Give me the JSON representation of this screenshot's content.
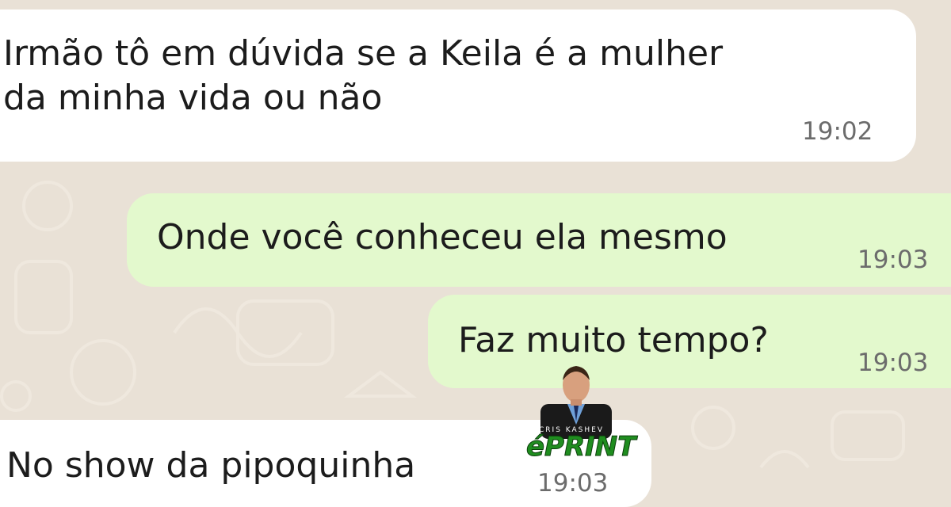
{
  "messages": [
    {
      "direction": "incoming",
      "text": "Irmão tô em dúvida se a Keila é a mulher\nda minha vida ou não",
      "time": "19:02"
    },
    {
      "direction": "outgoing",
      "text": "Onde você conheceu ela mesmo",
      "time": "19:03"
    },
    {
      "direction": "outgoing",
      "text": "Faz muito tempo?",
      "time": "19:03"
    },
    {
      "direction": "incoming",
      "text": "No show da pipoquinha",
      "time": "19:03"
    }
  ],
  "watermark": {
    "tag": "CRIS KASHEV",
    "brand": "éPRINT"
  },
  "colors": {
    "background": "#e9e1d6",
    "incoming_bubble": "#ffffff",
    "outgoing_bubble": "#e3f9cd",
    "time_text": "#6c6c6c"
  }
}
